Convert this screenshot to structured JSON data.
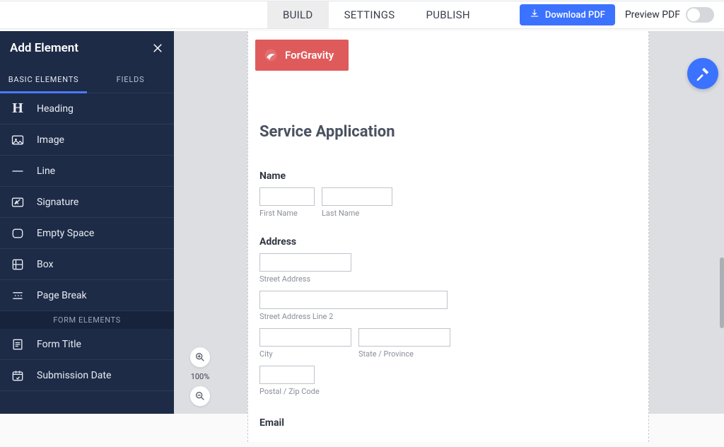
{
  "topnav": {
    "tabs": [
      "BUILD",
      "SETTINGS",
      "PUBLISH"
    ],
    "activeIndex": 0,
    "download_label": "Download PDF",
    "preview_label": "Preview PDF"
  },
  "sidebar": {
    "title": "Add Element",
    "tabs": [
      "BASIC ELEMENTS",
      "FIELDS"
    ],
    "activeTabIndex": 0,
    "basic_items": [
      {
        "icon": "heading-icon",
        "label": "Heading"
      },
      {
        "icon": "image-icon",
        "label": "Image"
      },
      {
        "icon": "line-icon",
        "label": "Line"
      },
      {
        "icon": "signature-icon",
        "label": "Signature"
      },
      {
        "icon": "empty-space-icon",
        "label": "Empty Space"
      },
      {
        "icon": "box-icon",
        "label": "Box"
      },
      {
        "icon": "page-break-icon",
        "label": "Page Break"
      }
    ],
    "form_section_label": "FORM ELEMENTS",
    "form_items": [
      {
        "icon": "form-title-icon",
        "label": "Form Title"
      },
      {
        "icon": "submission-date-icon",
        "label": "Submission Date"
      }
    ]
  },
  "brand": {
    "name": "ForGravity"
  },
  "form": {
    "title": "Service Application",
    "name_label": "Name",
    "first_name_sub": "First Name",
    "last_name_sub": "Last Name",
    "address_label": "Address",
    "street_sub": "Street Address",
    "street2_sub": "Street Address Line 2",
    "city_sub": "City",
    "state_sub": "State / Province",
    "postal_sub": "Postal / Zip Code",
    "email_label": "Email"
  },
  "zoom": {
    "level_text": "100%"
  }
}
